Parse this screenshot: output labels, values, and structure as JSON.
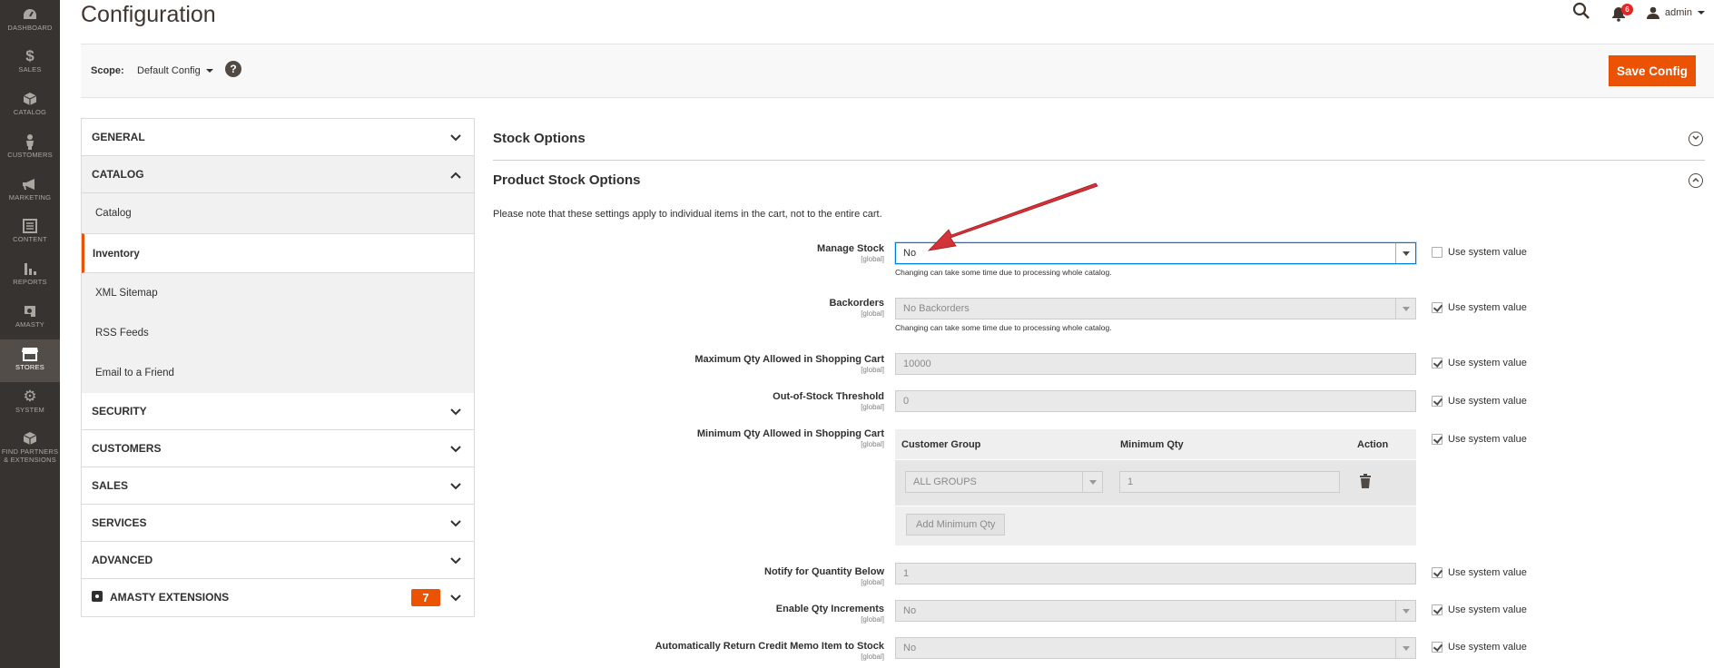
{
  "admin_menu": [
    {
      "label": "DASHBOARD",
      "icon": "dashboard-icon"
    },
    {
      "label": "SALES",
      "icon": "dollar-icon"
    },
    {
      "label": "CATALOG",
      "icon": "box-icon"
    },
    {
      "label": "CUSTOMERS",
      "icon": "person-icon"
    },
    {
      "label": "MARKETING",
      "icon": "megaphone-icon"
    },
    {
      "label": "CONTENT",
      "icon": "content-icon"
    },
    {
      "label": "REPORTS",
      "icon": "bar-chart-icon"
    },
    {
      "label": "AMASTY",
      "icon": "amasty-icon"
    },
    {
      "label": "STORES",
      "icon": "store-icon",
      "active": true
    },
    {
      "label": "SYSTEM",
      "icon": "gear-icon"
    },
    {
      "label_line1": "FIND PARTNERS",
      "label_line2": "& EXTENSIONS",
      "icon": "extensions-icon"
    }
  ],
  "header": {
    "title": "Configuration",
    "notification_count": "6",
    "user_name": "admin"
  },
  "scope": {
    "label": "Scope:",
    "value": "Default Config",
    "help": "?",
    "save_label": "Save Config"
  },
  "tabs": {
    "general": "GENERAL",
    "catalog": "CATALOG",
    "catalog_items": [
      "Catalog",
      "Inventory",
      "XML Sitemap",
      "RSS Feeds",
      "Email to a Friend"
    ],
    "security": "SECURITY",
    "customers": "CUSTOMERS",
    "sales": "SALES",
    "services": "SERVICES",
    "advanced": "ADVANCED",
    "amasty": "AMASTY EXTENSIONS",
    "amasty_badge": "7"
  },
  "content": {
    "stock_options_title": "Stock Options",
    "product_stock_title": "Product Stock Options",
    "note": "Please note that these settings apply to individual items in the cart, not to the entire cart.",
    "scope_tag": "[global]",
    "use_system_value": "Use system value",
    "hint_catalog": "Changing can take some time due to processing whole catalog.",
    "fields": {
      "manage_stock": {
        "label": "Manage Stock",
        "value": "No",
        "use_system": false
      },
      "backorders": {
        "label": "Backorders",
        "value": "No Backorders",
        "use_system": true
      },
      "max_qty": {
        "label": "Maximum Qty Allowed in Shopping Cart",
        "value": "10000",
        "use_system": true
      },
      "oos_threshold": {
        "label": "Out-of-Stock Threshold",
        "value": "0",
        "use_system": true
      },
      "min_qty": {
        "label": "Minimum Qty Allowed in Shopping Cart",
        "use_system": true
      },
      "notify_below": {
        "label": "Notify for Quantity Below",
        "value": "1",
        "use_system": true
      },
      "qty_increments": {
        "label": "Enable Qty Increments",
        "value": "No",
        "use_system": true
      },
      "return_credit_memo": {
        "label": "Automatically Return Credit Memo Item to Stock",
        "value": "No",
        "use_system": true
      }
    },
    "min_qty_table": {
      "col_group": "Customer Group",
      "col_qty": "Minimum Qty",
      "col_action": "Action",
      "group_value": "ALL GROUPS",
      "qty_value": "1",
      "add_label": "Add Minimum Qty"
    }
  },
  "colors": {
    "accent": "#eb5202",
    "menu_bg": "#373330",
    "annotation_arrow": "#d9262d"
  }
}
